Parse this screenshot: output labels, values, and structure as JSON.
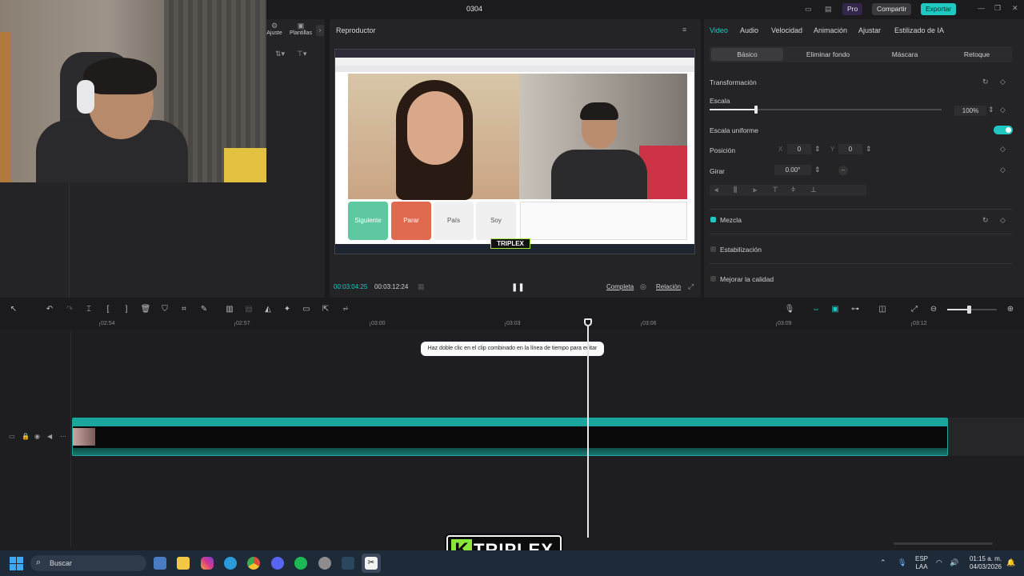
{
  "app": {
    "window_title": "0304",
    "pro_label": "Pro",
    "share_label": "Compartir",
    "export_label": "Exportar"
  },
  "left_panel": {
    "tab_adjust": "Ajuste",
    "tab_templates": "Plantillas"
  },
  "player": {
    "header": "Reproductor",
    "current_time": "00:03:04:25",
    "total_time": "00:03:12:24",
    "full_label": "Completa",
    "ratio_label": "Relación",
    "watermark": "TRIPLEX",
    "screen_buttons": [
      "Siguiente",
      "Parar",
      "País",
      "Soy"
    ]
  },
  "inspector": {
    "tabs": [
      "Video",
      "Audio",
      "Velocidad",
      "Animación",
      "Ajustar",
      "Estilizado de IA"
    ],
    "sub_tabs": [
      "Básico",
      "Eliminar fondo",
      "Máscara",
      "Retoque"
    ],
    "transform_label": "Transformación",
    "scale_label": "Escala",
    "scale_value": "100%",
    "scale_fraction": 0.2,
    "uniform_scale_label": "Escala uniforme",
    "position_label": "Posición",
    "pos_x_label": "X",
    "pos_x_value": "0",
    "pos_y_label": "Y",
    "pos_y_value": "0",
    "rotate_label": "Girar",
    "rotate_value": "0.00°",
    "blend_label": "Mezcla",
    "stabilize_label": "Estabilización",
    "enhance_label": "Mejorar la calidad"
  },
  "timeline": {
    "ruler": [
      "02:54",
      "02:57",
      "03:00",
      "03:03",
      "03:06",
      "03:09",
      "03:12"
    ],
    "tooltip": "Haz doble clic en el clip combinado en la línea de tiempo para editar"
  },
  "taskbar": {
    "search_placeholder": "Buscar",
    "lang_top": "ESP",
    "lang_bottom": "LAA",
    "time": "01:15 a. m.",
    "date": "04/03/2026"
  },
  "overlay_logo": "TRIPLEX",
  "colors": {
    "accent": "#1fc8c0",
    "clip_border": "#1aa59d",
    "next_button": "#5ec8a0",
    "stop_button": "#e06a50"
  }
}
